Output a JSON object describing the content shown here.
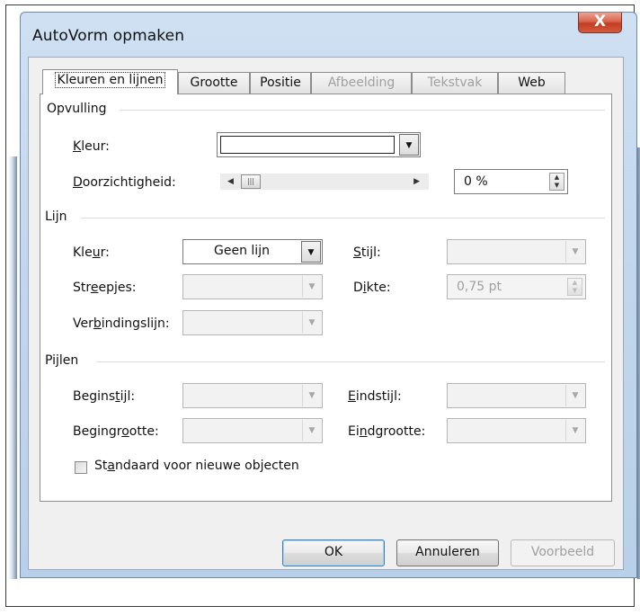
{
  "window": {
    "title": "AutoVorm opmaken",
    "close_glyph": "X"
  },
  "tabs": [
    {
      "label": "Kleuren en lijnen",
      "active": true,
      "disabled": false
    },
    {
      "label": "Grootte",
      "active": false,
      "disabled": false
    },
    {
      "label": "Positie",
      "active": false,
      "disabled": false
    },
    {
      "label": "Afbeelding",
      "active": false,
      "disabled": true
    },
    {
      "label": "Tekstvak",
      "active": false,
      "disabled": true
    },
    {
      "label": "Web",
      "active": false,
      "disabled": false
    }
  ],
  "fill": {
    "section": "Opvulling",
    "color_label_pre": "",
    "color_label_ul": "K",
    "color_label_post": "leur:",
    "color_value": "#ffffff",
    "transparency_label_ul": "D",
    "transparency_label_post": "oorzichtigheid:",
    "transparency_value": "0 %",
    "transparency_level": 0
  },
  "line": {
    "section": "Lijn",
    "color_label_pre": "Kle",
    "color_label_ul": "u",
    "color_label_post": "r:",
    "color_value": "Geen lijn",
    "style_label_pre": "",
    "style_label_ul": "S",
    "style_label_post": "tijl:",
    "dashes_label_pre": "Str",
    "dashes_label_ul": "e",
    "dashes_label_post": "epjes:",
    "weight_label_pre": "D",
    "weight_label_ul": "i",
    "weight_label_post": "kte:",
    "weight_value": "0,75 pt",
    "connector_label_pre": "Ver",
    "connector_label_ul": "b",
    "connector_label_post": "indingslijn:"
  },
  "arrows": {
    "section": "Pijlen",
    "begin_style_pre": "Begins",
    "begin_style_ul": "t",
    "begin_style_post": "ijl:",
    "end_style_pre": "",
    "end_style_ul": "E",
    "end_style_post": "indstijl:",
    "begin_size_pre": "Begingr",
    "begin_size_ul": "o",
    "begin_size_post": "otte:",
    "end_size_pre": "Ei",
    "end_size_ul": "n",
    "end_size_post": "dgrootte:"
  },
  "default_checkbox": {
    "pre": "St",
    "ul": "a",
    "post": "ndaard voor nieuwe objecten",
    "checked": false
  },
  "buttons": {
    "ok": "OK",
    "cancel": "Annuleren",
    "preview": "Voorbeeld"
  },
  "colors": {
    "window_frame": "#c3d8ee",
    "close_button": "#c9442a",
    "default_button_border": "#3c7fb1"
  }
}
